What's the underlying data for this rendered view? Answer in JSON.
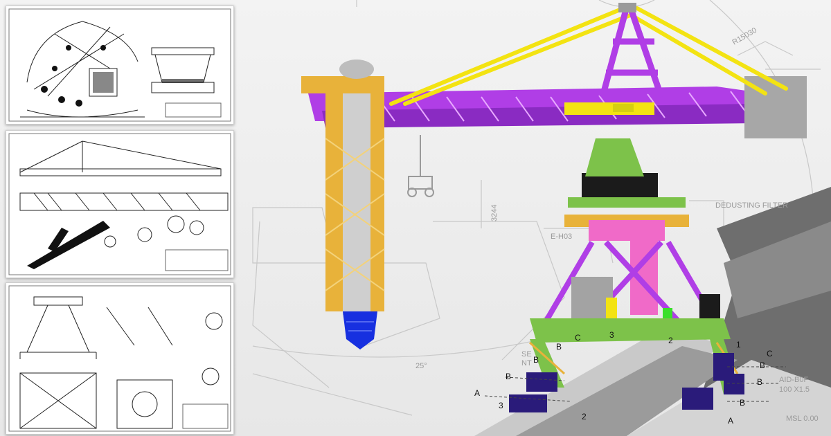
{
  "drawing": {
    "dimension_radius": "R15030",
    "dimension_height": "3244",
    "angle_label": "25°",
    "equipment_label": "DEDUSTING FILTER",
    "hopper_label": "E-H03",
    "side_note_1": "SE",
    "side_note_2": "NT",
    "tag_1": "AID-B0F",
    "tag_2": "100 X1.5",
    "tag_3": "MSL 0.00",
    "rail_labels": [
      "A",
      "B",
      "C",
      "1",
      "2",
      "3"
    ]
  },
  "colors": {
    "boom": "#b03ee6",
    "stays": "#f3e312",
    "column": "#e8b23a",
    "pink": "#f06ac8",
    "green": "#7dc24a",
    "blue": "#1730e0"
  }
}
